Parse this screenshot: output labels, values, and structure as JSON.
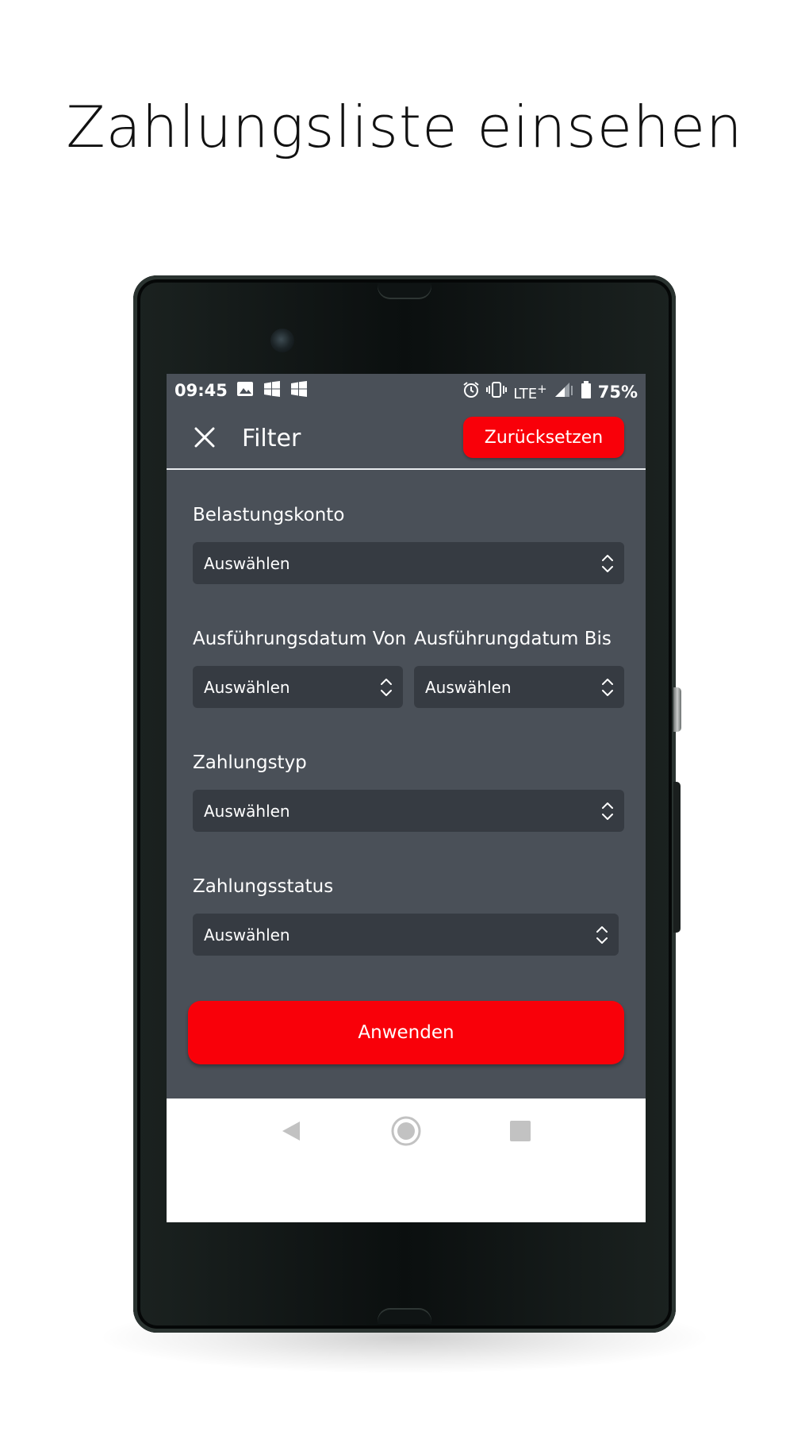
{
  "headline": "Zahlungsliste einsehen",
  "status_bar": {
    "time": "09:45",
    "network": "LTE",
    "network_suffix": "+",
    "battery": "75%",
    "icons": [
      "image-icon",
      "windows-icon",
      "windows-icon",
      "alarm-icon",
      "vibrate-icon",
      "signal-icon",
      "battery-icon"
    ]
  },
  "appbar": {
    "title": "Filter",
    "reset_label": "Zurücksetzen",
    "close_icon": "close-icon"
  },
  "form": {
    "debit_account": {
      "label": "Belastungskonto",
      "value": "Auswählen"
    },
    "execution_date_from": {
      "label": "Ausführungsdatum Von",
      "value": "Auswählen"
    },
    "execution_date_to": {
      "label": "Ausführungdatum Bis",
      "value": "Auswählen"
    },
    "payment_type": {
      "label": "Zahlungstyp",
      "value": "Auswählen"
    },
    "payment_status": {
      "label": "Zahlungsstatus",
      "value": "Auswählen"
    },
    "apply_label": "Anwenden"
  },
  "navigation_bar": {
    "icons": [
      "back-icon",
      "home-icon",
      "recent-apps-icon"
    ]
  },
  "colors": {
    "accent": "#f90009",
    "screen_background": "#4a5058",
    "field_background": "#363b42",
    "text": "#ffffff"
  }
}
